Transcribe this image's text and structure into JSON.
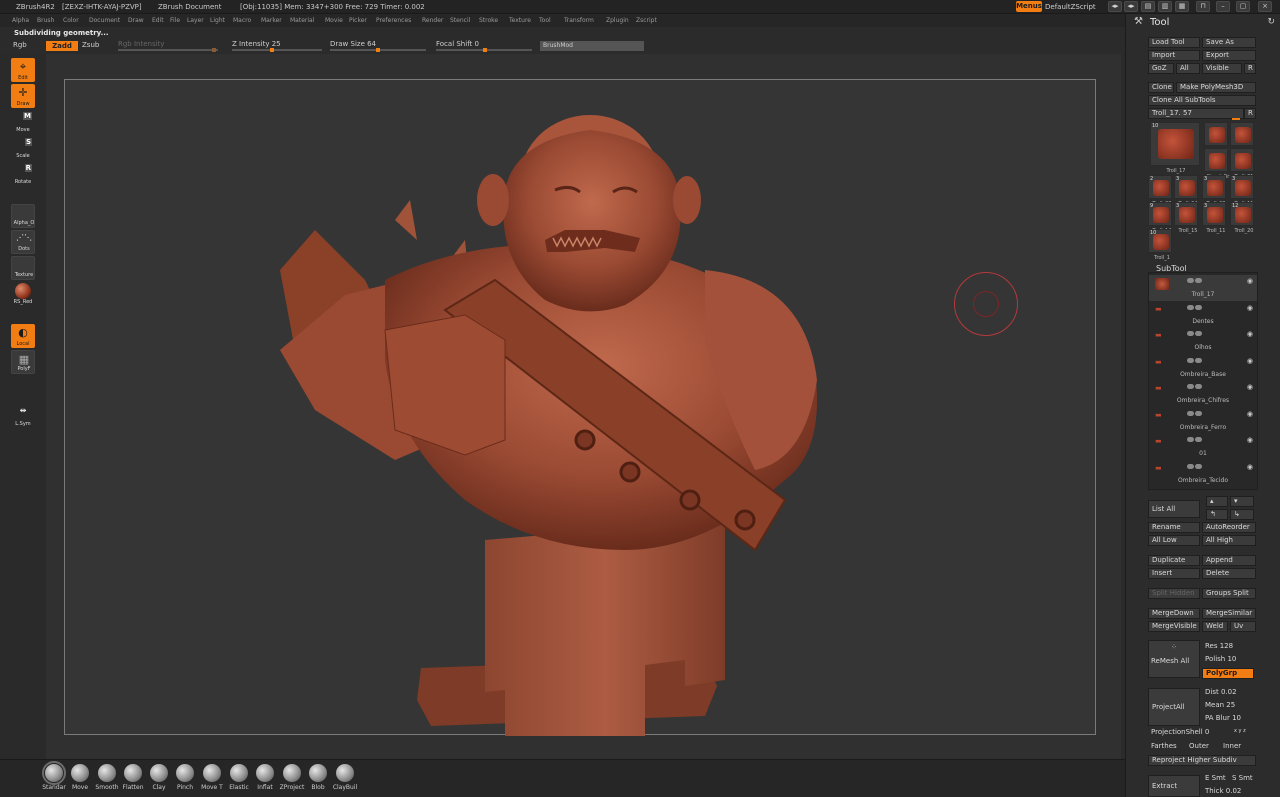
{
  "titlebar": {
    "app": "ZBrush4R2",
    "serial": "[ZEXZ-IHTK-AYAJ-PZVP]",
    "document": "ZBrush Document",
    "stats": "[Obj:11035]  Mem: 3347+300  Free: 729  Timer: 0.002",
    "menus_label": "Menus",
    "script_label": "DefaultZScript"
  },
  "menubar": [
    "Alpha",
    "Brush",
    "Color",
    "Document",
    "Draw",
    "Edit",
    "File",
    "Layer",
    "Light",
    "Macro",
    "Marker",
    "Material",
    "Movie",
    "Picker",
    "Preferences",
    "Render",
    "Stencil",
    "Stroke",
    "Texture",
    "Tool",
    "Transform",
    "Zplugin",
    "Zscript"
  ],
  "status": "Subdividing geometry...",
  "toolbar": {
    "rgb": "Rgb",
    "zadd": "Zadd",
    "zsub": "Zsub",
    "rgb_intensity": "Rgb  Intensity",
    "z_intensity": "Z Intensity 25",
    "draw_size": "Draw Size 64",
    "focal_shift": "Focal Shift 0",
    "brushmod": "BrushMod"
  },
  "leftshelf": {
    "edit": "Edit",
    "draw": "Draw",
    "move": "Move",
    "scale": "Scale",
    "rotate": "Rotate",
    "alpha": "Alpha_O",
    "dots": "Dots",
    "texture": "Texture",
    "material": "RS_Red",
    "local": "Local",
    "polyf": "PolyF",
    "lsym": "L.Sym"
  },
  "brushes": [
    "Standar",
    "Move",
    "Smooth",
    "Flatten",
    "Clay",
    "Pinch",
    "Move T",
    "Elastic",
    "Inflat",
    "ZProject",
    "Blob",
    "ClayBuil"
  ],
  "tool": {
    "title": "Tool",
    "load": "Load Tool",
    "save": "Save As",
    "import": "Import",
    "export": "Export",
    "goz": "GoZ",
    "all": "All",
    "visible": "Visible",
    "r": "R",
    "clone": "Clone",
    "make_poly": "Make PolyMesh3D",
    "clone_all": "Clone All SubTools",
    "current": "Troll_17. 57",
    "thumbs": [
      {
        "n": "10",
        "label": "Troll_17"
      },
      {
        "n": "",
        "label": "Cylinder"
      },
      {
        "n": "",
        "label": "PolyMes"
      },
      {
        "n": "",
        "label": "SimpleBr"
      },
      {
        "n": "",
        "label": "Troll_01"
      },
      {
        "n": "2",
        "label": "Troll_03"
      },
      {
        "n": "3",
        "label": "Troll_04"
      },
      {
        "n": "3",
        "label": "Troll_08"
      },
      {
        "n": "3",
        "label": "Troll_11"
      },
      {
        "n": "9",
        "label": "Troll_14"
      },
      {
        "n": "3",
        "label": "Troll_15"
      },
      {
        "n": "3",
        "label": "Troll_11"
      },
      {
        "n": "12",
        "label": "Troll_20"
      },
      {
        "n": "10",
        "label": "Troll_1"
      }
    ],
    "subtool_title": "SubTool",
    "subtools": [
      "Troll_17",
      "Dentes",
      "Olhos",
      "Ombreira_Base",
      "Ombreira_Chifres",
      "Ombreira_Ferro",
      "01",
      "Ombreira_Tecido"
    ],
    "list_all": "List All",
    "rename": "Rename",
    "autoreorder": "AutoReorder",
    "all_low": "All Low",
    "all_high": "All High",
    "duplicate": "Duplicate",
    "append": "Append",
    "insert": "Insert",
    "delete": "Delete",
    "split_hidden": "Split Hidden",
    "groups_split": "Groups Split",
    "merge_down": "MergeDown",
    "merge_similar": "MergeSimilar",
    "merge_visible": "MergeVisible",
    "weld": "Weld",
    "uv": "Uv",
    "remesh_all": "ReMesh All",
    "res": "Res 128",
    "polish": "Polish 10",
    "polygrp": "PolyGrp",
    "project_all": "ProjectAll",
    "dist": "Dist 0.02",
    "mean": "Mean 25",
    "pa_blur": "PA Blur 10",
    "projection_shell": "ProjectionShell 0",
    "xyz": "x y z",
    "farthest": "Farthes",
    "outer": "Outer",
    "inner": "Inner",
    "reproject": "Reproject Higher Subdiv",
    "extract": "Extract",
    "e_smt": "E Smt",
    "s_smt": "S Smt",
    "thick": "Thick 0.02"
  },
  "colors": {
    "accent": "#f27d13",
    "model": "#a4513b",
    "cursor": "#b33a3a"
  }
}
